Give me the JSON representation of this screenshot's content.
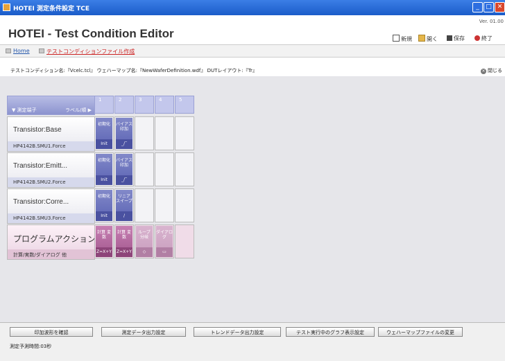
{
  "window": {
    "title": "HOTEI 測定条件設定 TCE"
  },
  "header": {
    "title": "HOTEI - Test Condition Editor",
    "version": "Ver. 01.00"
  },
  "toolbar": {
    "new_label": "新規",
    "open_label": "開く",
    "save_label": "保存",
    "exit_label": "終了"
  },
  "breadcrumb": {
    "home": "Home",
    "current": "テストコンディションファイル作成"
  },
  "info": {
    "text": "テストコンディション名:『Vcelc.tcl』 ウェハーマップ名:『NewWaferDefinition.wdf』 DUTレイアウト:『Tr』",
    "close_label": "閉じる"
  },
  "grid": {
    "header_left": "▼ 測定端子",
    "header_right": "ラベル/順 ▶",
    "columns": [
      "1",
      "2",
      "3",
      "4",
      "5"
    ],
    "rows": [
      {
        "name": "Transistor:Base",
        "sub": "HP4142B.SMU1.Force",
        "actions": [
          {
            "top": "初期化",
            "bottom": "Init"
          },
          {
            "top": "バイアス 印加",
            "bottom": "_/‾"
          }
        ]
      },
      {
        "name": "Transistor:Emitt...",
        "sub": "HP4142B.SMU2.Force",
        "actions": [
          {
            "top": "初期化",
            "bottom": "Init"
          },
          {
            "top": "バイアス 印加",
            "bottom": "_/‾"
          }
        ]
      },
      {
        "name": "Transistor:Corre...",
        "sub": "HP4142B.SMU3.Force",
        "actions": [
          {
            "top": "初期化",
            "bottom": "Init"
          },
          {
            "top": "リニア スイープ",
            "bottom": "/"
          }
        ]
      },
      {
        "name": "プログラムアクション",
        "sub": "計算/実数/ダイアログ 他",
        "actions": [
          {
            "top": "計算 変数",
            "bottom": "Z=X+Y"
          },
          {
            "top": "計算 変数",
            "bottom": "Z=X+Y"
          },
          {
            "top": "ループ 分岐",
            "bottom": "◇"
          },
          {
            "top": "ダイアログ",
            "bottom": "▭"
          }
        ]
      }
    ]
  },
  "bottom": {
    "buttons": [
      "印加波形を確認",
      "測定データ出力設定",
      "トレンドデータ出力設定",
      "テスト実行中のグラフ表示設定",
      "ウェハーマップファイルの変更"
    ],
    "estimate": "測定予測時間:03秒"
  }
}
